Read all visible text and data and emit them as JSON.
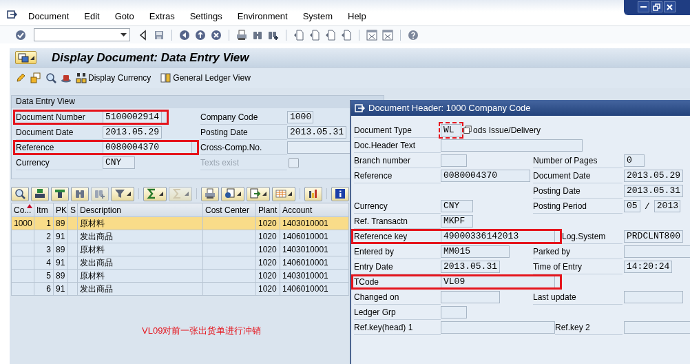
{
  "menu": [
    "Document",
    "Edit",
    "Goto",
    "Extras",
    "Settings",
    "Environment",
    "System",
    "Help"
  ],
  "screen_title": "Display Document: Data Entry View",
  "app_toolbar": [
    {
      "label": "Display Currency"
    },
    {
      "label": "General Ledger View"
    }
  ],
  "group": {
    "title": "Data Entry View",
    "left": [
      {
        "label": "Document Number",
        "value": "5100002914",
        "highlighted": true
      },
      {
        "label": "Document Date",
        "value": "2013.05.29",
        "highlighted": false
      },
      {
        "label": "Reference",
        "value": "0080004370",
        "highlighted": true
      },
      {
        "label": "Currency",
        "value": "CNY",
        "highlighted": false
      }
    ],
    "right": [
      {
        "kind": "field",
        "label": "Company Code",
        "value": "1000"
      },
      {
        "kind": "field",
        "label": "Posting Date",
        "value": "2013.05.31"
      },
      {
        "kind": "field",
        "label": "Cross-Comp.No."
      },
      {
        "kind": "checkbox",
        "label": "Texts exist",
        "disabled": true,
        "checked": false
      }
    ]
  },
  "table": {
    "columns": [
      {
        "label": "Co...",
        "sorted": true
      },
      {
        "label": "Itm",
        "sorted": false
      },
      {
        "label": "PK",
        "sorted": false
      },
      {
        "label": "S",
        "sorted": false
      },
      {
        "label": "Description",
        "sorted": false
      },
      {
        "label": "Cost Center",
        "sorted": false
      },
      {
        "label": "Plant",
        "sorted": false
      },
      {
        "label": "Account",
        "sorted": false
      }
    ],
    "rows": [
      {
        "selected": true,
        "cells": [
          "1000",
          "1",
          "89",
          null,
          "原材料",
          null,
          "1020",
          "1403010001"
        ]
      },
      {
        "selected": false,
        "cells": [
          null,
          "2",
          "91",
          null,
          "发出商品",
          null,
          "1020",
          "1406010001"
        ]
      },
      {
        "selected": false,
        "cells": [
          null,
          "3",
          "89",
          null,
          "原材料",
          null,
          "1020",
          "1403010001"
        ]
      },
      {
        "selected": false,
        "cells": [
          null,
          "4",
          "91",
          null,
          "发出商品",
          null,
          "1020",
          "1406010001"
        ]
      },
      {
        "selected": false,
        "cells": [
          null,
          "5",
          "89",
          null,
          "原材料",
          null,
          "1020",
          "1403010001"
        ]
      },
      {
        "selected": false,
        "cells": [
          null,
          "6",
          "91",
          null,
          "发出商品",
          null,
          "1020",
          "1406010001"
        ]
      }
    ]
  },
  "annotation": "VL09对前一张出货单进行冲销",
  "dialog": {
    "title": "Document Header: 1000 Company Code",
    "rows": [
      {
        "left": {
          "label": "Document Type",
          "value": "WL",
          "focused": true,
          "description": "ods Issue/Delivery"
        }
      },
      {
        "left": {
          "label": "Doc.Header Text"
        }
      },
      {
        "left": {
          "label": "Branch number"
        },
        "right": {
          "label": "Number of Pages",
          "value": "0"
        }
      },
      {
        "left": {
          "label": "Reference",
          "value": "0080004370"
        },
        "right": {
          "label": "Document Date",
          "value": "2013.05.29"
        }
      },
      {
        "right": {
          "label": "Posting Date",
          "value": "2013.05.31"
        }
      },
      {
        "left": {
          "label": "Currency",
          "value": "CNY"
        },
        "right": {
          "label": "Posting Period",
          "values": [
            "05",
            "2013"
          ],
          "separator": "/"
        }
      },
      {
        "left": {
          "label": "Ref. Transactn",
          "value": "MKPF"
        }
      },
      {
        "left": {
          "label": "Reference key",
          "value": "49000336142013",
          "highlighted": true
        },
        "right": {
          "label": "Log.System",
          "value": "PRDCLNT800"
        }
      },
      {
        "left": {
          "label": "Entered by",
          "value": "MM015"
        },
        "right": {
          "label": "Parked by"
        }
      },
      {
        "left": {
          "label": "Entry Date",
          "value": "2013.05.31"
        },
        "right": {
          "label": "Time of Entry",
          "value": "14:20:24"
        }
      },
      {
        "left": {
          "label": "TCode",
          "value": "VL09",
          "highlighted": true
        }
      },
      {
        "left": {
          "label": "Changed on"
        },
        "right": {
          "label": "Last update"
        }
      },
      {
        "left": {
          "label": "Ledger Grp"
        }
      },
      {
        "left": {
          "label": "Ref.key(head) 1"
        },
        "right": {
          "label": "Ref.key 2"
        }
      }
    ]
  }
}
